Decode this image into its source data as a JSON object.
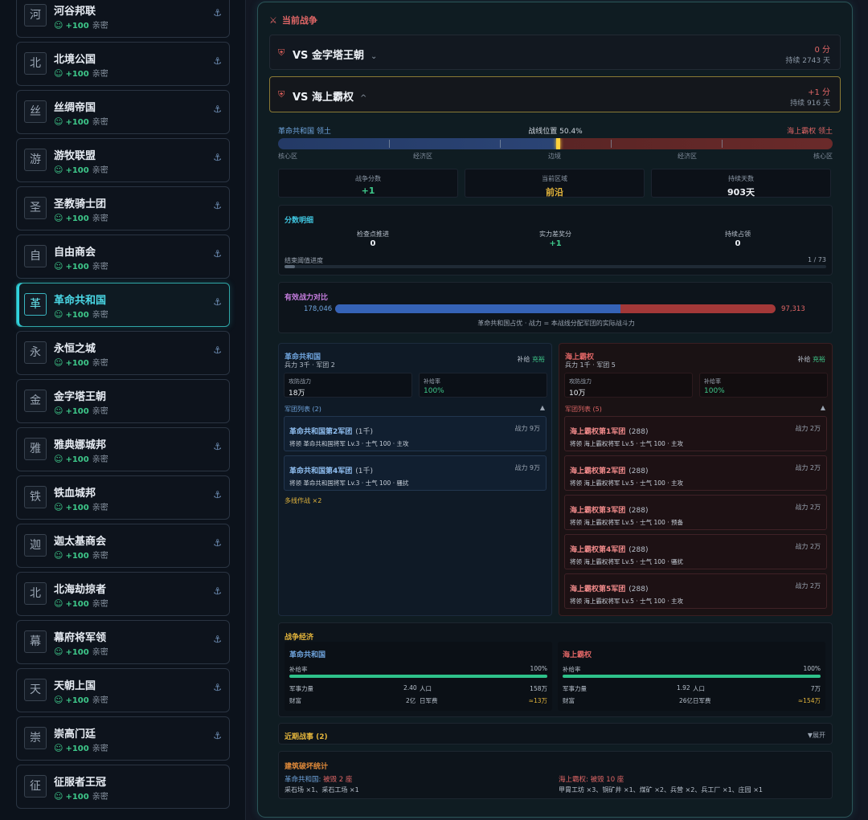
{
  "sidebar": {
    "items": [
      {
        "glyph": "河",
        "name": "河谷邦联",
        "value": "+100",
        "relation": "亲密",
        "active": false
      },
      {
        "glyph": "北",
        "name": "北境公国",
        "value": "+100",
        "relation": "亲密",
        "active": false
      },
      {
        "glyph": "丝",
        "name": "丝绸帝国",
        "value": "+100",
        "relation": "亲密",
        "active": false
      },
      {
        "glyph": "游",
        "name": "游牧联盟",
        "value": "+100",
        "relation": "亲密",
        "active": false
      },
      {
        "glyph": "圣",
        "name": "圣教骑士团",
        "value": "+100",
        "relation": "亲密",
        "active": false
      },
      {
        "glyph": "自",
        "name": "自由商会",
        "value": "+100",
        "relation": "亲密",
        "active": false
      },
      {
        "glyph": "革",
        "name": "革命共和国",
        "value": "+100",
        "relation": "亲密",
        "active": true
      },
      {
        "glyph": "永",
        "name": "永恒之城",
        "value": "+100",
        "relation": "亲密",
        "active": false
      },
      {
        "glyph": "金",
        "name": "金字塔王朝",
        "value": "+100",
        "relation": "亲密",
        "active": false,
        "no_anchor": true
      },
      {
        "glyph": "雅",
        "name": "雅典娜城邦",
        "value": "+100",
        "relation": "亲密",
        "active": false
      },
      {
        "glyph": "铁",
        "name": "铁血城邦",
        "value": "+100",
        "relation": "亲密",
        "active": false
      },
      {
        "glyph": "迦",
        "name": "迦太基商会",
        "value": "+100",
        "relation": "亲密",
        "active": false
      },
      {
        "glyph": "北",
        "name": "北海劫掠者",
        "value": "+100",
        "relation": "亲密",
        "active": false
      },
      {
        "glyph": "幕",
        "name": "幕府将军领",
        "value": "+100",
        "relation": "亲密",
        "active": false
      },
      {
        "glyph": "天",
        "name": "天朝上国",
        "value": "+100",
        "relation": "亲密",
        "active": false
      },
      {
        "glyph": "崇",
        "name": "崇高门廷",
        "value": "+100",
        "relation": "亲密",
        "active": false
      },
      {
        "glyph": "征",
        "name": "征服者王冠",
        "value": "+100",
        "relation": "亲密",
        "active": false,
        "no_anchor": true
      }
    ]
  },
  "main": {
    "header": "当前战争",
    "wars": [
      {
        "title": "VS 金字塔王朝",
        "score": "0 分",
        "duration": "持续 2743 天",
        "chevron": "⌄"
      },
      {
        "title": "VS 海上霸权",
        "score": "+1 分",
        "duration": "持续 916 天",
        "chevron": "^"
      }
    ],
    "front": {
      "left_label": "革命共和国 领土",
      "center_label": "战线位置 50.4%",
      "right_label": "海上霸权 领土",
      "position_fraction": 0.504,
      "zones": [
        "核心区",
        "经济区",
        "边境",
        "经济区",
        "核心区"
      ]
    },
    "stats": [
      {
        "label": "战争分数",
        "value": "+1",
        "color": "#3ec88a"
      },
      {
        "label": "当前区域",
        "value": "前沿",
        "color": "#e3b53c"
      },
      {
        "label": "持续天数",
        "value": "903天",
        "color": "#eef2f7"
      }
    ],
    "score_detail": {
      "title": "分数明细",
      "items": [
        {
          "label": "检查点推进",
          "value": "0"
        },
        {
          "label": "实力差奖分",
          "value": "+1"
        },
        {
          "label": "持续占领",
          "value": "0"
        }
      ],
      "threshold_label": "结束阈值进度",
      "threshold_value": "1 / 73",
      "threshold_fraction": 0.0137
    },
    "power": {
      "title": "有效战力对比",
      "left_value": "178,046",
      "right_value": "97,313",
      "left_fraction": 0.647,
      "note": "革命共和国占优 · 战力 = 本战线分配军团的实际战斗力"
    },
    "sides": [
      {
        "name": "革命共和国",
        "sub": "兵力 3千 · 军团 2",
        "supply_label": "补给",
        "supply_value": "充裕",
        "attack_label": "攻防战力",
        "attack_value": "18万",
        "supply_rate_label": "补给率",
        "supply_rate_value": "100%",
        "legions_label": "军团列表 (2)",
        "legions": [
          {
            "name": "革命共和国第2军团",
            "size": "(1千)",
            "power": "战力 9万",
            "detail": "将领 革命共和国将军 Lv.3 · 士气 100 · 主攻"
          },
          {
            "name": "革命共和国第4军团",
            "size": "(1千)",
            "power": "战力 9万",
            "detail": "将领 革命共和国将军 Lv.3 · 士气 100 · 骚扰"
          }
        ],
        "multi": "多线作战 ×2"
      },
      {
        "name": "海上霸权",
        "sub": "兵力 1千 · 军团 5",
        "supply_label": "补给",
        "supply_value": "充裕",
        "attack_label": "攻防战力",
        "attack_value": "10万",
        "supply_rate_label": "补给率",
        "supply_rate_value": "100%",
        "legions_label": "军团列表 (5)",
        "legions": [
          {
            "name": "海上霸权第1军团",
            "size": "(288)",
            "power": "战力 2万",
            "detail": "将领 海上霸权将军 Lv.5 · 士气 100 · 主攻"
          },
          {
            "name": "海上霸权第2军团",
            "size": "(288)",
            "power": "战力 2万",
            "detail": "将领 海上霸权将军 Lv.5 · 士气 100 · 主攻"
          },
          {
            "name": "海上霸权第3军团",
            "size": "(288)",
            "power": "战力 2万",
            "detail": "将领 海上霸权将军 Lv.5 · 士气 100 · 预备"
          },
          {
            "name": "海上霸权第4军团",
            "size": "(288)",
            "power": "战力 2万",
            "detail": "将领 海上霸权将军 Lv.5 · 士气 100 · 骚扰"
          },
          {
            "name": "海上霸权第5军团",
            "size": "(288)",
            "power": "战力 2万",
            "detail": "将领 海上霸权将军 Lv.5 · 士气 100 · 主攻"
          }
        ]
      }
    ],
    "economy": {
      "title": "战争经济",
      "sides": [
        {
          "name": "革命共和国",
          "supply_label": "补给率",
          "supply_value": "100%",
          "supply_fraction": 1.0,
          "military_label": "军事力量",
          "military_value": "2.40",
          "pop_label": "人口",
          "pop_value": "158万",
          "wealth_label": "财富",
          "wealth_value": "2亿",
          "cost_label": "日军费",
          "cost_value": "≈13万"
        },
        {
          "name": "海上霸权",
          "supply_label": "补给率",
          "supply_value": "100%",
          "supply_fraction": 1.0,
          "military_label": "军事力量",
          "military_value": "1.92",
          "pop_label": "人口",
          "pop_value": "7万",
          "wealth_label": "财富",
          "wealth_value": "26亿",
          "cost_label": "日军费",
          "cost_value": "≈154万"
        }
      ]
    },
    "recent": {
      "title": "近期战事 (2)",
      "toggle": "▼展开"
    },
    "buildings": {
      "title": "建筑破坏统计",
      "left_name": "革命共和国:",
      "left_summary": "被毁 2 座",
      "left_detail": "采石场 ×1、采石工场 ×1",
      "right_name": "海上霸权:",
      "right_summary": "被毁 10 座",
      "right_detail": "甲胄工坊 ×3、铜矿井 ×1、煤矿 ×2、兵营 ×2、兵工厂 ×1、庄园 ×1"
    }
  }
}
